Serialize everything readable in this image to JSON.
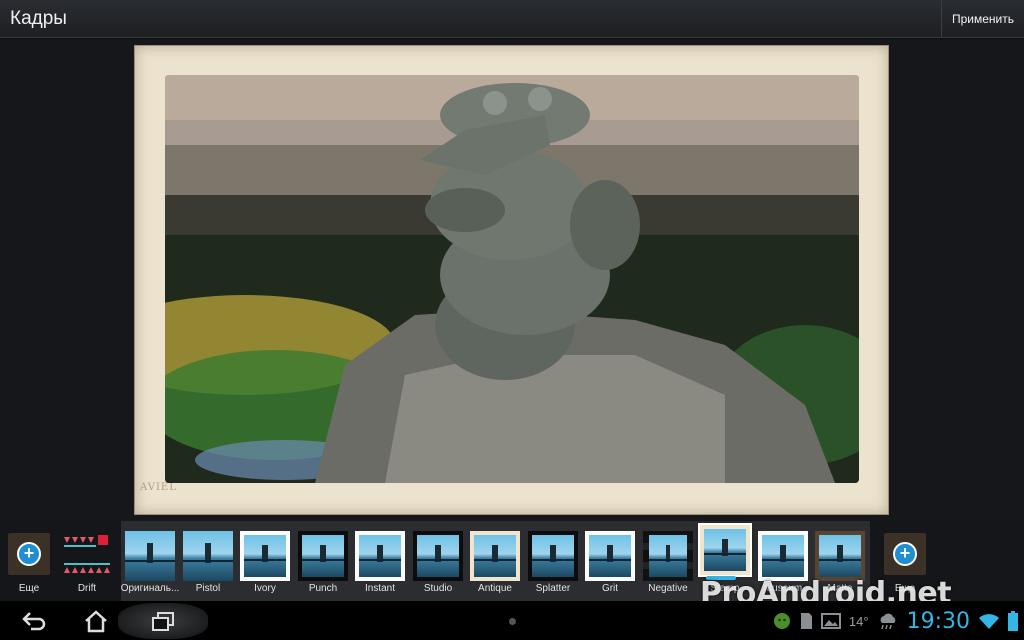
{
  "app": {
    "title": "Кадры",
    "apply_label": "Применить"
  },
  "frame": {
    "stamp_text": "AVIEL"
  },
  "strip": {
    "more_left_label": "Еще",
    "more_right_label": "Еще",
    "drift_label": "Drift",
    "filters": [
      {
        "label": "Оригиналь...",
        "style": "plain",
        "selected": false
      },
      {
        "label": "Pistol",
        "style": "plain",
        "selected": false
      },
      {
        "label": "Ivory",
        "style": "white",
        "selected": false
      },
      {
        "label": "Punch",
        "style": "black",
        "selected": false
      },
      {
        "label": "Instant",
        "style": "white",
        "selected": false
      },
      {
        "label": "Studio",
        "style": "black",
        "selected": false
      },
      {
        "label": "Antique",
        "style": "cream",
        "selected": false
      },
      {
        "label": "Splatter",
        "style": "black",
        "selected": false
      },
      {
        "label": "Grit",
        "style": "white",
        "selected": false
      },
      {
        "label": "Negative",
        "style": "film",
        "selected": false
      },
      {
        "label": "Stamp",
        "style": "cream",
        "selected": true
      },
      {
        "label": "Museum",
        "style": "white",
        "selected": false
      },
      {
        "label": "Matte",
        "style": "brown",
        "selected": false
      }
    ]
  },
  "watermark": "ProAndroid.net",
  "status_bar": {
    "temperature": "14°",
    "time": "19:30",
    "icons": [
      "android-icon",
      "sd-card-icon",
      "gallery-icon",
      "weather-icon",
      "wifi-icon",
      "battery-icon"
    ]
  },
  "nav": {
    "icons": [
      "back-icon",
      "home-icon",
      "recent-apps-icon"
    ]
  },
  "colors": {
    "accent": "#33b5e5",
    "frame": "#ece3cf",
    "action_bar": "#1d1f23"
  }
}
